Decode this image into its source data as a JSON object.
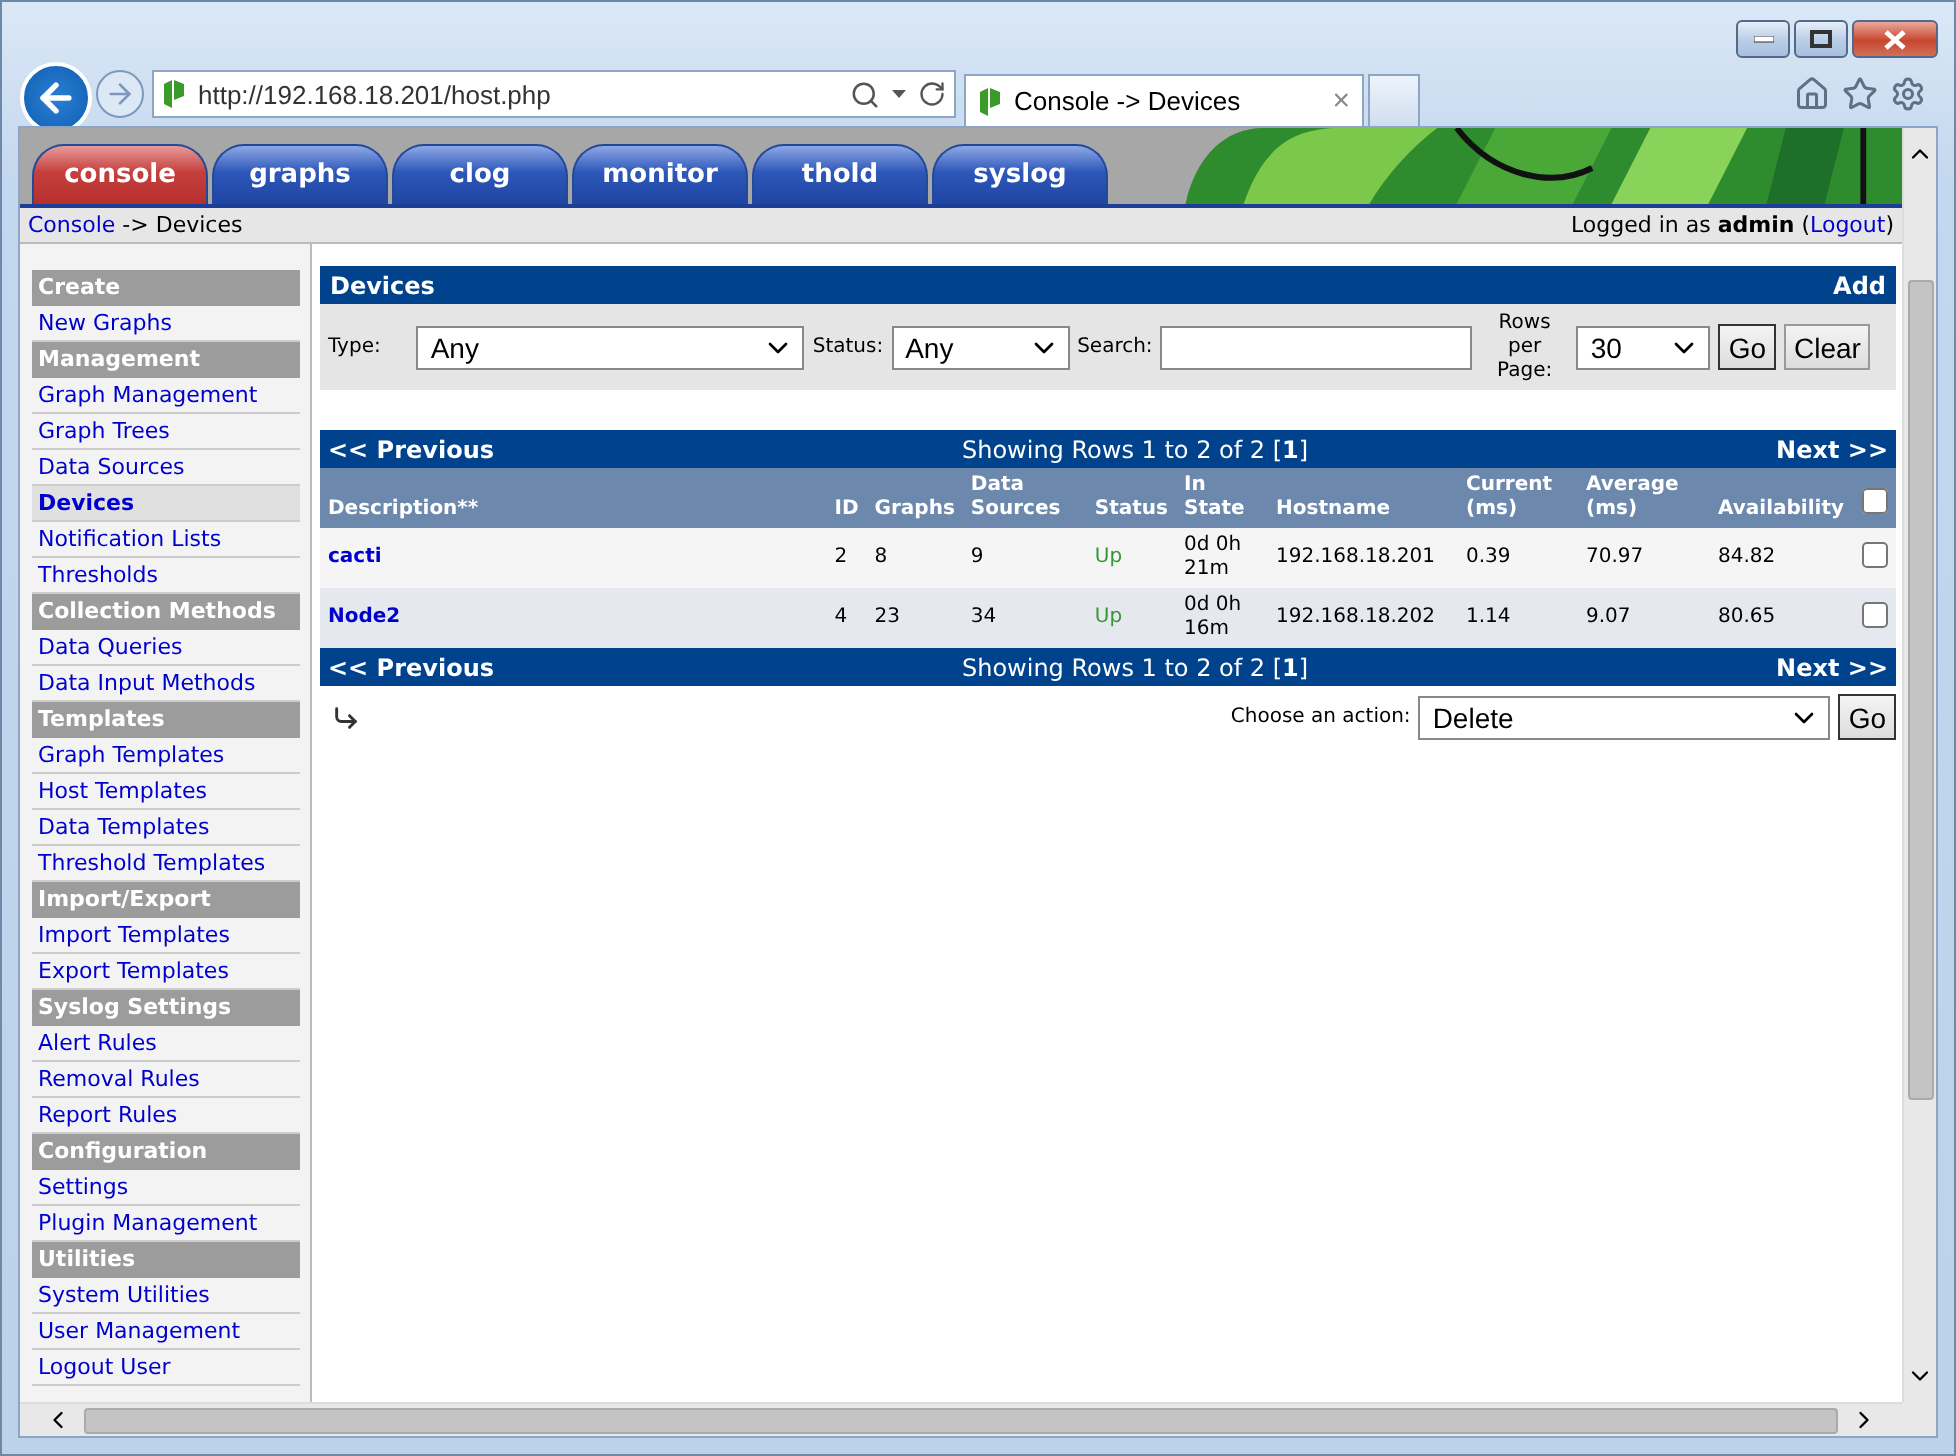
{
  "browser": {
    "address": "http://192.168.18.201/host.php",
    "tab_title": "Console -> Devices",
    "tab_close": "×"
  },
  "nav_tabs": [
    {
      "label": "console",
      "selected": true
    },
    {
      "label": "graphs",
      "selected": false
    },
    {
      "label": "clog",
      "selected": false
    },
    {
      "label": "monitor",
      "selected": false
    },
    {
      "label": "thold",
      "selected": false
    },
    {
      "label": "syslog",
      "selected": false
    }
  ],
  "breadcrumb": {
    "link": "Console",
    "rest": "-> Devices"
  },
  "login": {
    "text": "Logged in as **admin** (",
    "logout": "Logout",
    "suffix": ")"
  },
  "sidebar": [
    {
      "heading": "Create",
      "items": [
        {
          "label": "New Graphs",
          "selected": false
        }
      ]
    },
    {
      "heading": "Management",
      "items": [
        {
          "label": "Graph Management",
          "selected": false
        },
        {
          "label": "Graph Trees",
          "selected": false
        },
        {
          "label": "Data Sources",
          "selected": false
        },
        {
          "label": "Devices",
          "selected": true
        },
        {
          "label": "Notification Lists",
          "selected": false
        },
        {
          "label": "Thresholds",
          "selected": false
        }
      ]
    },
    {
      "heading": "Collection Methods",
      "items": [
        {
          "label": "Data Queries",
          "selected": false
        },
        {
          "label": "Data Input Methods",
          "selected": false
        }
      ]
    },
    {
      "heading": "Templates",
      "items": [
        {
          "label": "Graph Templates",
          "selected": false
        },
        {
          "label": "Host Templates",
          "selected": false
        },
        {
          "label": "Data Templates",
          "selected": false
        },
        {
          "label": "Threshold Templates",
          "selected": false
        }
      ]
    },
    {
      "heading": "Import/Export",
      "items": [
        {
          "label": "Import Templates",
          "selected": false
        },
        {
          "label": "Export Templates",
          "selected": false
        }
      ]
    },
    {
      "heading": "Syslog Settings",
      "items": [
        {
          "label": "Alert Rules",
          "selected": false
        },
        {
          "label": "Removal Rules",
          "selected": false
        },
        {
          "label": "Report Rules",
          "selected": false
        }
      ]
    },
    {
      "heading": "Configuration",
      "items": [
        {
          "label": "Settings",
          "selected": false
        },
        {
          "label": "Plugin Management",
          "selected": false
        }
      ]
    },
    {
      "heading": "Utilities",
      "items": [
        {
          "label": "System Utilities",
          "selected": false
        },
        {
          "label": "User Management",
          "selected": false
        },
        {
          "label": "Logout User",
          "selected": false
        }
      ]
    }
  ],
  "devices": {
    "title": "Devices",
    "add": "Add",
    "filters": {
      "type_label": "Type:",
      "type_value": "Any",
      "status_label": "Status:",
      "status_value": "Any",
      "search_label": "Search:",
      "rows_label": "Rows per Page:",
      "rows_value": "30",
      "go": "Go",
      "clear": "Clear"
    },
    "pager_top": {
      "previous": "<< Previous",
      "info": "Showing Rows 1 to 2 of 2 [**1**]",
      "next": "Next >>"
    },
    "columns": [
      "Description**",
      "ID",
      "Graphs",
      "Data Sources",
      "Status",
      "In State",
      "Hostname",
      "Current (ms)",
      "Average (ms)",
      "Availability"
    ],
    "select_all_checked": false,
    "rows": [
      {
        "cells": [
          "cacti",
          "2",
          "8",
          "9",
          "Up",
          "0d 0h 21m",
          "192.168.18.201",
          "0.39",
          "70.97",
          "84.82"
        ],
        "checked": false
      },
      {
        "cells": [
          "Node2",
          "4",
          "23",
          "34",
          "Up",
          "0d 0h 16m",
          "192.168.18.202",
          "1.14",
          "9.07",
          "80.65"
        ],
        "checked": false
      }
    ],
    "pager_bottom": {
      "previous": "<< Previous",
      "info": "Showing Rows 1 to 2 of 2 [**1**]",
      "next": "Next >>"
    },
    "action_label": "Choose an action:",
    "action_value": "Delete",
    "action_go": "Go"
  }
}
